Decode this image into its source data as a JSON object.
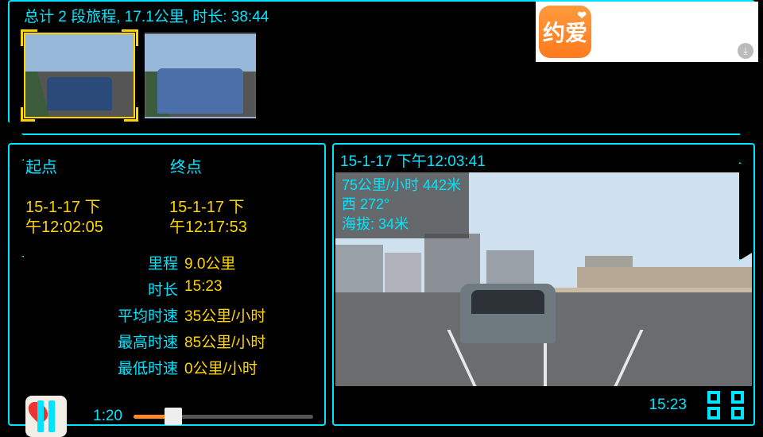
{
  "summary": "总计 2 段旅程, 17.1公里, 时长: 38:44",
  "ad": {
    "label": "约爱"
  },
  "thumbnails": [
    {
      "selected": true
    },
    {
      "selected": false
    }
  ],
  "stats": {
    "headers": {
      "start": "起点",
      "end": "终点"
    },
    "start_time_l1": "15-1-17 下",
    "start_time_l2": "午12:02:05",
    "end_time_l1": "15-1-17 下",
    "end_time_l2": "午12:17:53",
    "rows": {
      "distance_label": "里程",
      "distance_value": "9.0公里",
      "duration_label": "时长",
      "duration_value": "15:23",
      "avg_label": "平均时速",
      "avg_value": "35公里/小时",
      "max_label": "最高时速",
      "max_value": "85公里/小时",
      "min_label": "最低时速",
      "min_value": "0公里/小时"
    }
  },
  "player": {
    "position": "1:20",
    "progress_pct": 22
  },
  "video": {
    "timestamp": "15-1-17 下午12:03:41",
    "overlay": {
      "speed_dist": "75公里/小时  442米",
      "heading": "西  272°",
      "altitude": "海拔: 34米"
    },
    "duration": "15:23"
  }
}
